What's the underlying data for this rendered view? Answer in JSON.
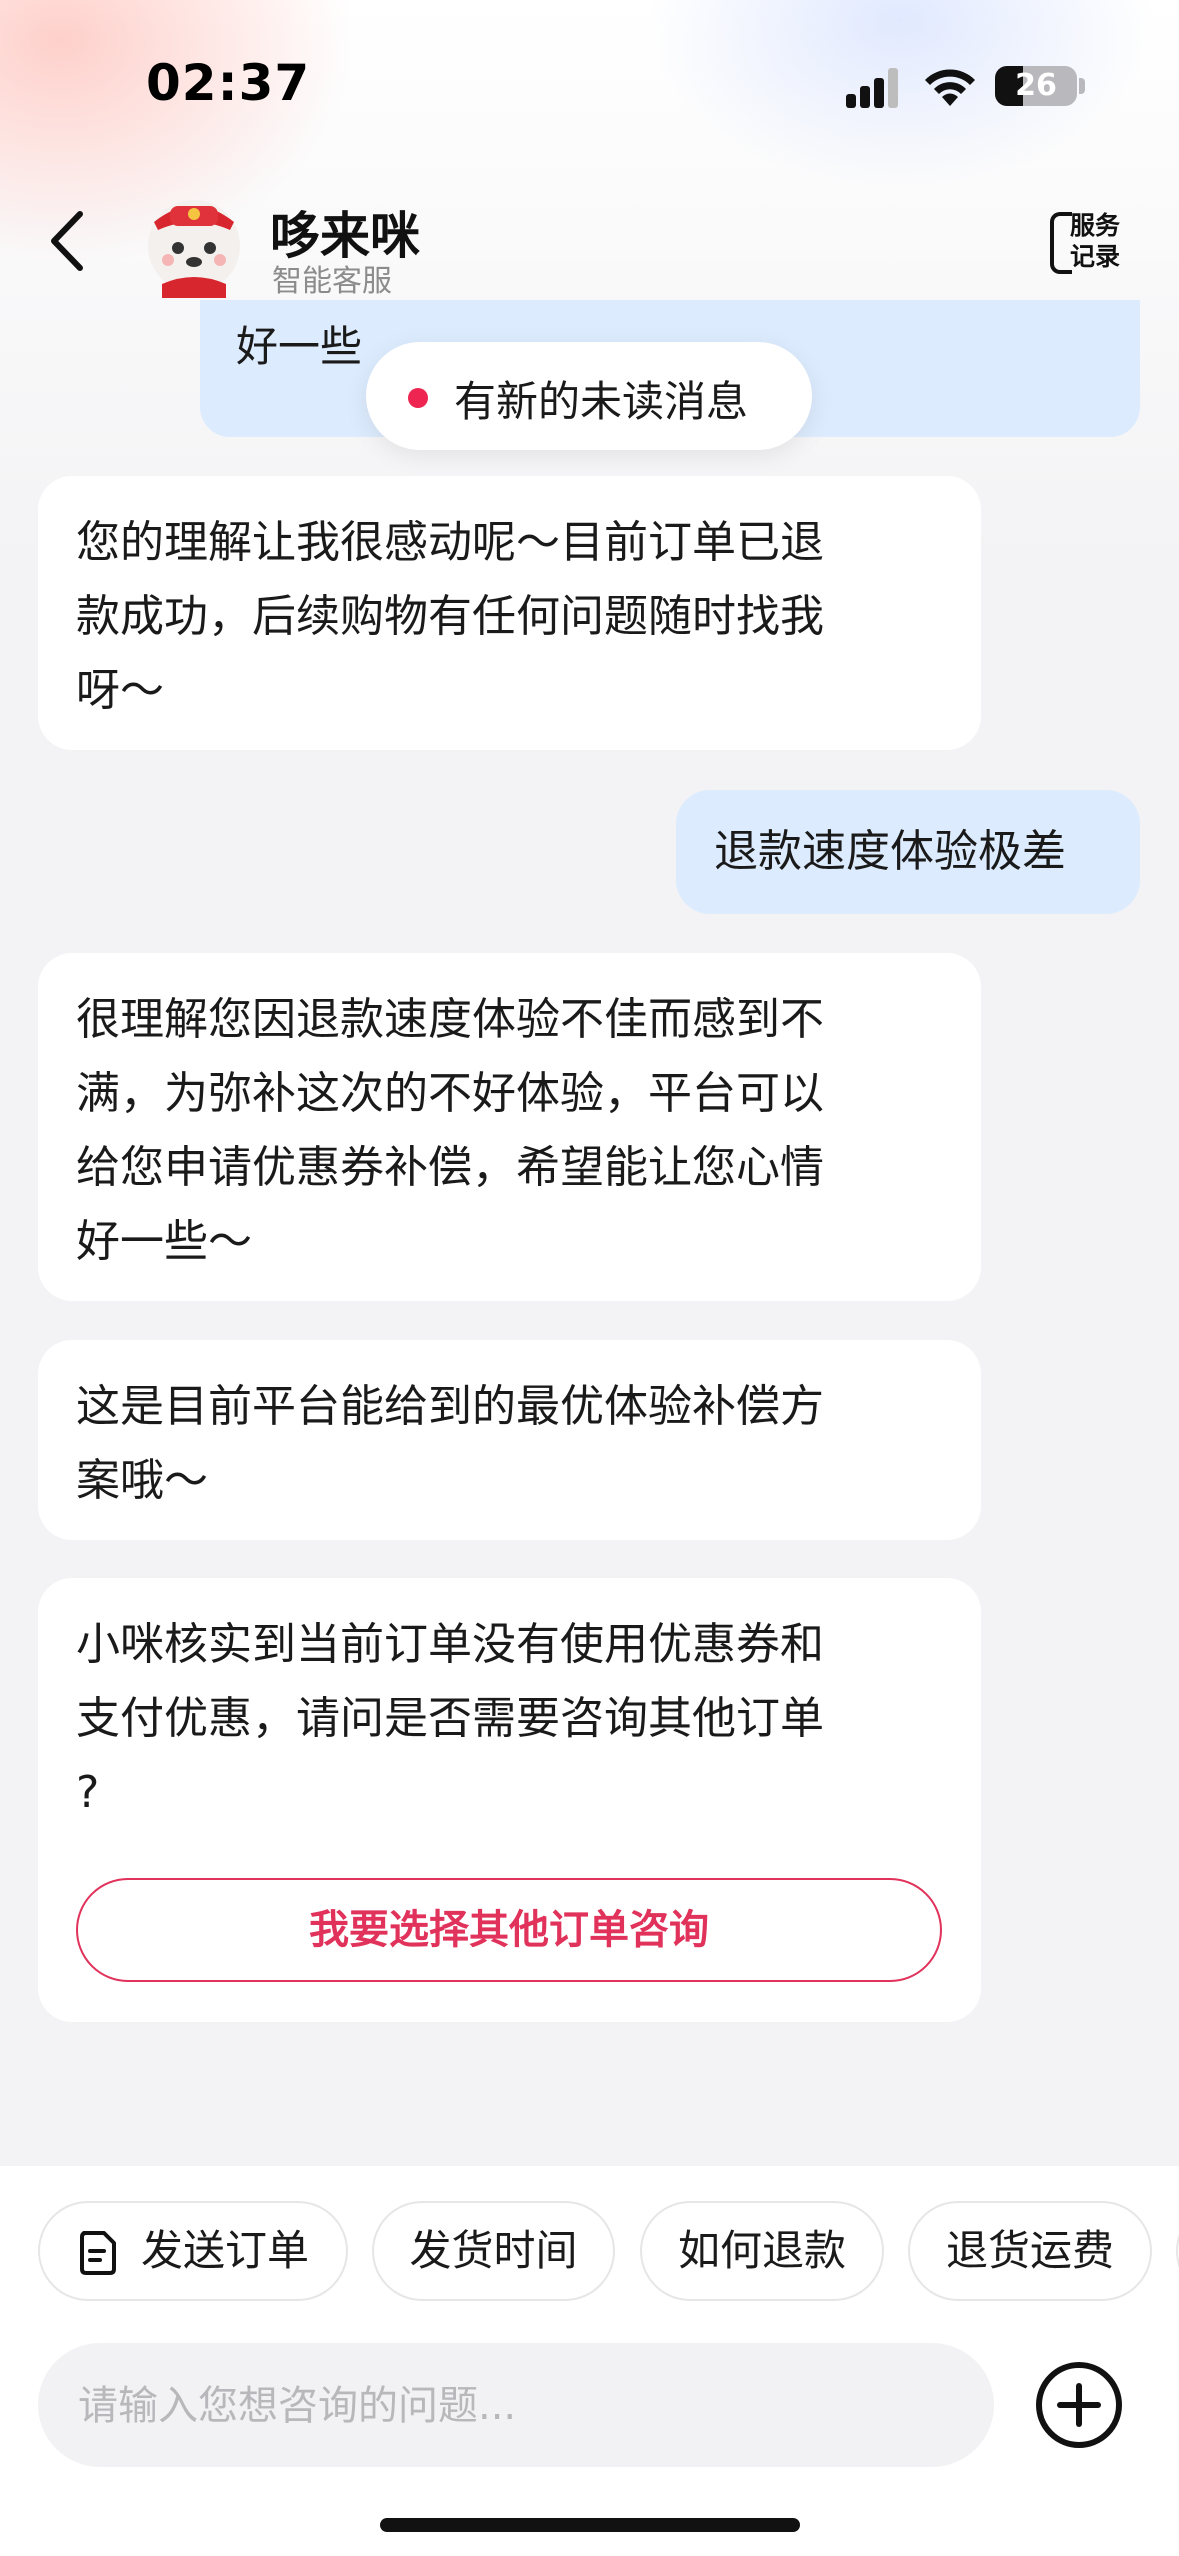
{
  "status_bar": {
    "time": "02:37",
    "battery": "26"
  },
  "header": {
    "title": "哆来咪",
    "subtitle": "智能客服",
    "service_records": [
      "服务",
      "记录"
    ],
    "back_icon": "chevron-left-icon",
    "service_icon": "service-record-icon"
  },
  "chat": {
    "partial_user_message_line": "好一些",
    "unread_notice": "有新的未读消息",
    "messages": [
      {
        "role": "bot",
        "lines": [
          "您的理解让我很感动呢～目前订单已退",
          "款成功，后续购物有任何问题随时找我",
          "呀～"
        ]
      },
      {
        "role": "user",
        "text": "退款速度体验极差"
      },
      {
        "role": "bot",
        "lines": [
          "很理解您因退款速度体验不佳而感到不",
          "满，为弥补这次的不好体验，平台可以",
          "给您申请优惠券补偿，希望能让您心情",
          "好一些～"
        ]
      },
      {
        "role": "bot",
        "lines": [
          "这是目前平台能给到的最优体验补偿方",
          "案哦～"
        ]
      },
      {
        "role": "bot",
        "lines": [
          "小咪核实到当前订单没有使用优惠券和",
          "支付优惠，请问是否需要咨询其他订单",
          "?"
        ],
        "button": "我要选择其他订单咨询"
      }
    ]
  },
  "quick_replies": [
    "发送订单",
    "发货时间",
    "如何退款",
    "退货运费"
  ],
  "input": {
    "placeholder": "请输入您想咨询的问题..."
  },
  "colors": {
    "accent": "#e0325a",
    "user_bubble": "#dcebfd",
    "unread_dot": "#ee2451"
  }
}
